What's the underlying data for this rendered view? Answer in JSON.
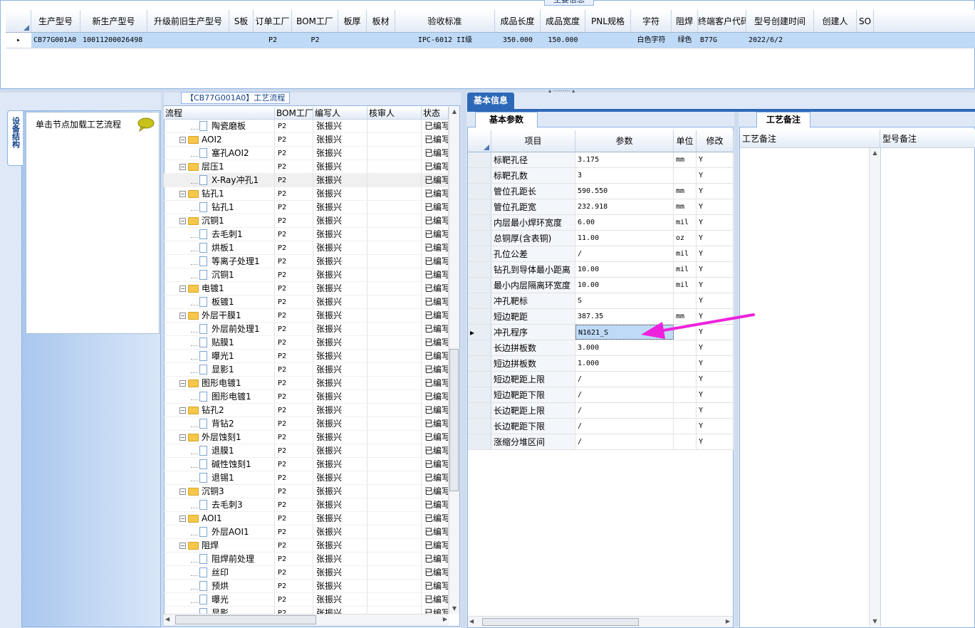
{
  "top": {
    "title": "主要信息",
    "headers": [
      "生产型号",
      "新生产型号",
      "升级前旧生产型号",
      "S板",
      "订单工厂",
      "BOM工厂",
      "板厚",
      "板材",
      "验收标准",
      "成品长度",
      "成品宽度",
      "PNL规格",
      "字符",
      "阻焊",
      "终端客户代码",
      "型号创建时间",
      "创建人",
      "SO"
    ],
    "row": [
      "CB77G001A0",
      "10011200026498",
      "",
      "",
      "P2",
      "P2",
      "",
      "",
      "IPC-6012 II级",
      "350.000",
      "150.000",
      "",
      "白色字符",
      "绿色",
      "B77G",
      "2022/6/2",
      "",
      ""
    ]
  },
  "left": {
    "vtab_label": "设备结构",
    "load_hint": "单击节点加载工艺流程"
  },
  "tree": {
    "title": "【CB77G001A0】工艺流程",
    "headers": [
      "流程",
      "BOM工厂",
      "编写人",
      "核审人",
      "状态"
    ],
    "rows": [
      {
        "name": "陶瓷磨板",
        "level": 1,
        "factory": "P2",
        "author": "张振兴",
        "status": "已编写"
      },
      {
        "name": "AOI2",
        "level": 0,
        "factory": "P2",
        "author": "张振兴",
        "status": "已编写"
      },
      {
        "name": "塞孔AOI2",
        "level": 1,
        "factory": "P2",
        "author": "张振兴",
        "status": "已编写"
      },
      {
        "name": "层压1",
        "level": 0,
        "factory": "P2",
        "author": "张振兴",
        "status": "已编写"
      },
      {
        "name": "X-Ray冲孔1",
        "level": 1,
        "factory": "P2",
        "author": "张振兴",
        "status": "已编写",
        "selected": true
      },
      {
        "name": "钻孔1",
        "level": 0,
        "factory": "P2",
        "author": "张振兴",
        "status": "已编写"
      },
      {
        "name": "钻孔1",
        "level": 1,
        "factory": "P2",
        "author": "张振兴",
        "status": "已编写"
      },
      {
        "name": "沉铜1",
        "level": 0,
        "factory": "P2",
        "author": "张振兴",
        "status": "已编写"
      },
      {
        "name": "去毛刺1",
        "level": 1,
        "factory": "P2",
        "author": "张振兴",
        "status": "已编写"
      },
      {
        "name": "烘板1",
        "level": 1,
        "factory": "P2",
        "author": "张振兴",
        "status": "已编写"
      },
      {
        "name": "等离子处理1",
        "level": 1,
        "factory": "P2",
        "author": "张振兴",
        "status": "已编写"
      },
      {
        "name": "沉铜1",
        "level": 1,
        "factory": "P2",
        "author": "张振兴",
        "status": "已编写"
      },
      {
        "name": "电镀1",
        "level": 0,
        "factory": "P2",
        "author": "张振兴",
        "status": "已编写"
      },
      {
        "name": "板镀1",
        "level": 1,
        "factory": "P2",
        "author": "张振兴",
        "status": "已编写"
      },
      {
        "name": "外层干膜1",
        "level": 0,
        "factory": "P2",
        "author": "张振兴",
        "status": "已编写"
      },
      {
        "name": "外层前处理1",
        "level": 1,
        "factory": "P2",
        "author": "张振兴",
        "status": "已编写"
      },
      {
        "name": "贴膜1",
        "level": 1,
        "factory": "P2",
        "author": "张振兴",
        "status": "已编写"
      },
      {
        "name": "曝光1",
        "level": 1,
        "factory": "P2",
        "author": "张振兴",
        "status": "已编写"
      },
      {
        "name": "显影1",
        "level": 1,
        "factory": "P2",
        "author": "张振兴",
        "status": "已编写"
      },
      {
        "name": "图形电镀1",
        "level": 0,
        "factory": "P2",
        "author": "张振兴",
        "status": "已编写"
      },
      {
        "name": "图形电镀1",
        "level": 1,
        "factory": "P2",
        "author": "张振兴",
        "status": "已编写"
      },
      {
        "name": "钻孔2",
        "level": 0,
        "factory": "P2",
        "author": "张振兴",
        "status": "已编写"
      },
      {
        "name": "背钻2",
        "level": 1,
        "factory": "P2",
        "author": "张振兴",
        "status": "已编写"
      },
      {
        "name": "外层蚀刻1",
        "level": 0,
        "factory": "P2",
        "author": "张振兴",
        "status": "已编写"
      },
      {
        "name": "退膜1",
        "level": 1,
        "factory": "P2",
        "author": "张振兴",
        "status": "已编写"
      },
      {
        "name": "碱性蚀刻1",
        "level": 1,
        "factory": "P2",
        "author": "张振兴",
        "status": "已编写"
      },
      {
        "name": "退锡1",
        "level": 1,
        "factory": "P2",
        "author": "张振兴",
        "status": "已编写"
      },
      {
        "name": "沉铜3",
        "level": 0,
        "factory": "P2",
        "author": "张振兴",
        "status": "已编写"
      },
      {
        "name": "去毛刺3",
        "level": 1,
        "factory": "P2",
        "author": "张振兴",
        "status": "已编写"
      },
      {
        "name": "AOI1",
        "level": 0,
        "factory": "P2",
        "author": "张振兴",
        "status": "已编写"
      },
      {
        "name": "外层AOI1",
        "level": 1,
        "factory": "P2",
        "author": "张振兴",
        "status": "已编写"
      },
      {
        "name": "阻焊",
        "level": 0,
        "factory": "P2",
        "author": "张振兴",
        "status": "已编写"
      },
      {
        "name": "阻焊前处理",
        "level": 1,
        "factory": "P2",
        "author": "张振兴",
        "status": "已编写"
      },
      {
        "name": "丝印",
        "level": 1,
        "factory": "P2",
        "author": "张振兴",
        "status": "已编写"
      },
      {
        "name": "预烘",
        "level": 1,
        "factory": "P2",
        "author": "张振兴",
        "status": "已编写"
      },
      {
        "name": "曝光",
        "level": 1,
        "factory": "P2",
        "author": "张振兴",
        "status": "已编写"
      },
      {
        "name": "显影",
        "level": 1,
        "factory": "P2",
        "author": "张振兴",
        "status": "已编写"
      }
    ]
  },
  "info": {
    "tab_label": "基本信息",
    "param_tab_label": "基本参数",
    "headers": [
      "项目",
      "参数",
      "单位",
      "修改"
    ],
    "rows": [
      {
        "item": "标靶孔径",
        "value": "3.175",
        "unit": "mm",
        "mod": "Y"
      },
      {
        "item": "标靶孔数",
        "value": "3",
        "unit": "",
        "mod": "Y"
      },
      {
        "item": "管位孔距长",
        "value": "590.550",
        "unit": "mm",
        "mod": "Y"
      },
      {
        "item": "管位孔距宽",
        "value": "232.918",
        "unit": "mm",
        "mod": "Y"
      },
      {
        "item": "内层最小焊环宽度",
        "value": "6.00",
        "unit": "mil",
        "mod": "Y"
      },
      {
        "item": "总铜厚(含表铜)",
        "value": "11.00",
        "unit": "oz",
        "mod": "Y"
      },
      {
        "item": "孔位公差",
        "value": "/",
        "unit": "mil",
        "mod": "Y"
      },
      {
        "item": "钻孔到导体最小距离",
        "value": "10.00",
        "unit": "mil",
        "mod": "Y"
      },
      {
        "item": "最小内层隔离环宽度",
        "value": "10.00",
        "unit": "mil",
        "mod": "Y"
      },
      {
        "item": "冲孔靶标",
        "value": "S",
        "unit": "",
        "mod": "Y"
      },
      {
        "item": "短边靶距",
        "value": "387.35",
        "unit": "mm",
        "mod": "Y"
      },
      {
        "item": "冲孔程序",
        "value": "N1621_S",
        "unit": "",
        "mod": "Y",
        "selected": true
      },
      {
        "item": "长边拼板数",
        "value": "3.000",
        "unit": "",
        "mod": "Y"
      },
      {
        "item": "短边拼板数",
        "value": "1.000",
        "unit": "",
        "mod": "Y"
      },
      {
        "item": "短边靶距上限",
        "value": "/",
        "unit": "",
        "mod": "Y"
      },
      {
        "item": "短边靶距下限",
        "value": "/",
        "unit": "",
        "mod": "Y"
      },
      {
        "item": "长边靶距上限",
        "value": "/",
        "unit": "",
        "mod": "Y"
      },
      {
        "item": "长边靶距下限",
        "value": "/",
        "unit": "",
        "mod": "Y"
      },
      {
        "item": "涨缩分堆区间",
        "value": "/",
        "unit": "",
        "mod": "Y"
      }
    ]
  },
  "remarks": {
    "tab_label": "工艺备注",
    "headers": [
      "工艺备注",
      "型号备注"
    ]
  },
  "colors": {
    "accent": "#2d68b8",
    "selection": "#bfdaf7",
    "arrow": "#ee22dd"
  }
}
